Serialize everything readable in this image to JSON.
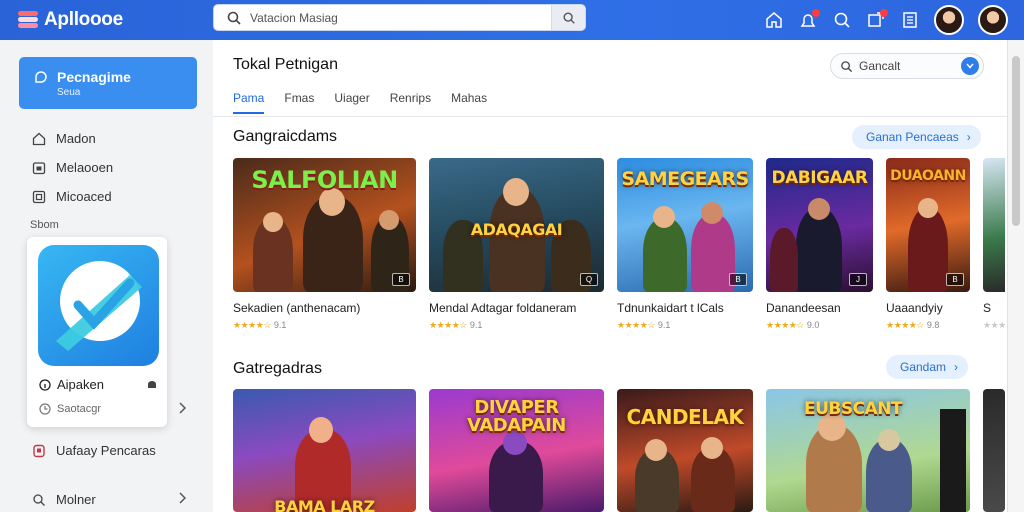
{
  "app": {
    "name": "Aplloooe"
  },
  "search": {
    "placeholder": "Vatacion Masiag"
  },
  "sidebar": {
    "hero": {
      "title": "Pecnagime",
      "subtitle": "Seua"
    },
    "items": [
      {
        "label": "Madon",
        "icon": "home-icon"
      },
      {
        "label": "Melaooen",
        "icon": "calendar-icon"
      },
      {
        "label": "Micoaced",
        "icon": "grid-icon"
      }
    ],
    "section_label": "Sbom",
    "app_card": {
      "name": "Aipaken",
      "sub": "Saotacgr"
    },
    "more_items": [
      {
        "label": "Uafaay Pencaras",
        "icon": "badge-icon"
      },
      {
        "label": "Molner",
        "icon": "search-icon"
      }
    ]
  },
  "main": {
    "title": "Tokal Petnigan",
    "search": "Gancalt",
    "tabs": [
      "Pama",
      "Fmas",
      "Uiager",
      "Renrips",
      "Mahas"
    ],
    "sections": [
      {
        "title": "Gangraicdams",
        "button": "Ganan Pencaeas",
        "games": [
          {
            "name": "Sekadien (anthenacam)",
            "art": "SALFOLIAN",
            "rating": "4.5",
            "count": "9.1",
            "badge": "B",
            "stars": "★★★★☆"
          },
          {
            "name": "Mendal Adtagar foldaneram",
            "art": "ADAQAGAI",
            "rating": "4.5",
            "count": "9.1",
            "badge": "Q",
            "stars": "★★★★☆"
          },
          {
            "name": "Tdnunkaidart t lCals",
            "art": "SAMEGEARS",
            "rating": "4.5",
            "count": "9.1",
            "badge": "B",
            "stars": "★★★★☆"
          },
          {
            "name": "Danandeesan",
            "art": "DABIGAAR",
            "rating": "4.5",
            "count": "9.0",
            "badge": "J",
            "stars": "★★★★☆"
          },
          {
            "name": "Uaaandyiy",
            "art": "DUAOANN",
            "rating": "4.5",
            "count": "9.8",
            "badge": "B",
            "stars": "★★★★☆"
          },
          {
            "name": "S",
            "art": "",
            "rating": "",
            "count": "",
            "badge": "",
            "stars": "★★★"
          }
        ]
      },
      {
        "title": "Gatregadras",
        "button": "Gandam",
        "games": [
          {
            "name": "",
            "art": "BAMA LARZ"
          },
          {
            "name": "",
            "art": "DIVAPER VADAPAIN"
          },
          {
            "name": "",
            "art": "CANDELAK"
          },
          {
            "name": "",
            "art": "EUBSCANT"
          }
        ]
      }
    ]
  },
  "colors": {
    "accent": "#2f6fe6",
    "sidebar_active": "#3a8ef0",
    "star": "#f2a91e"
  }
}
